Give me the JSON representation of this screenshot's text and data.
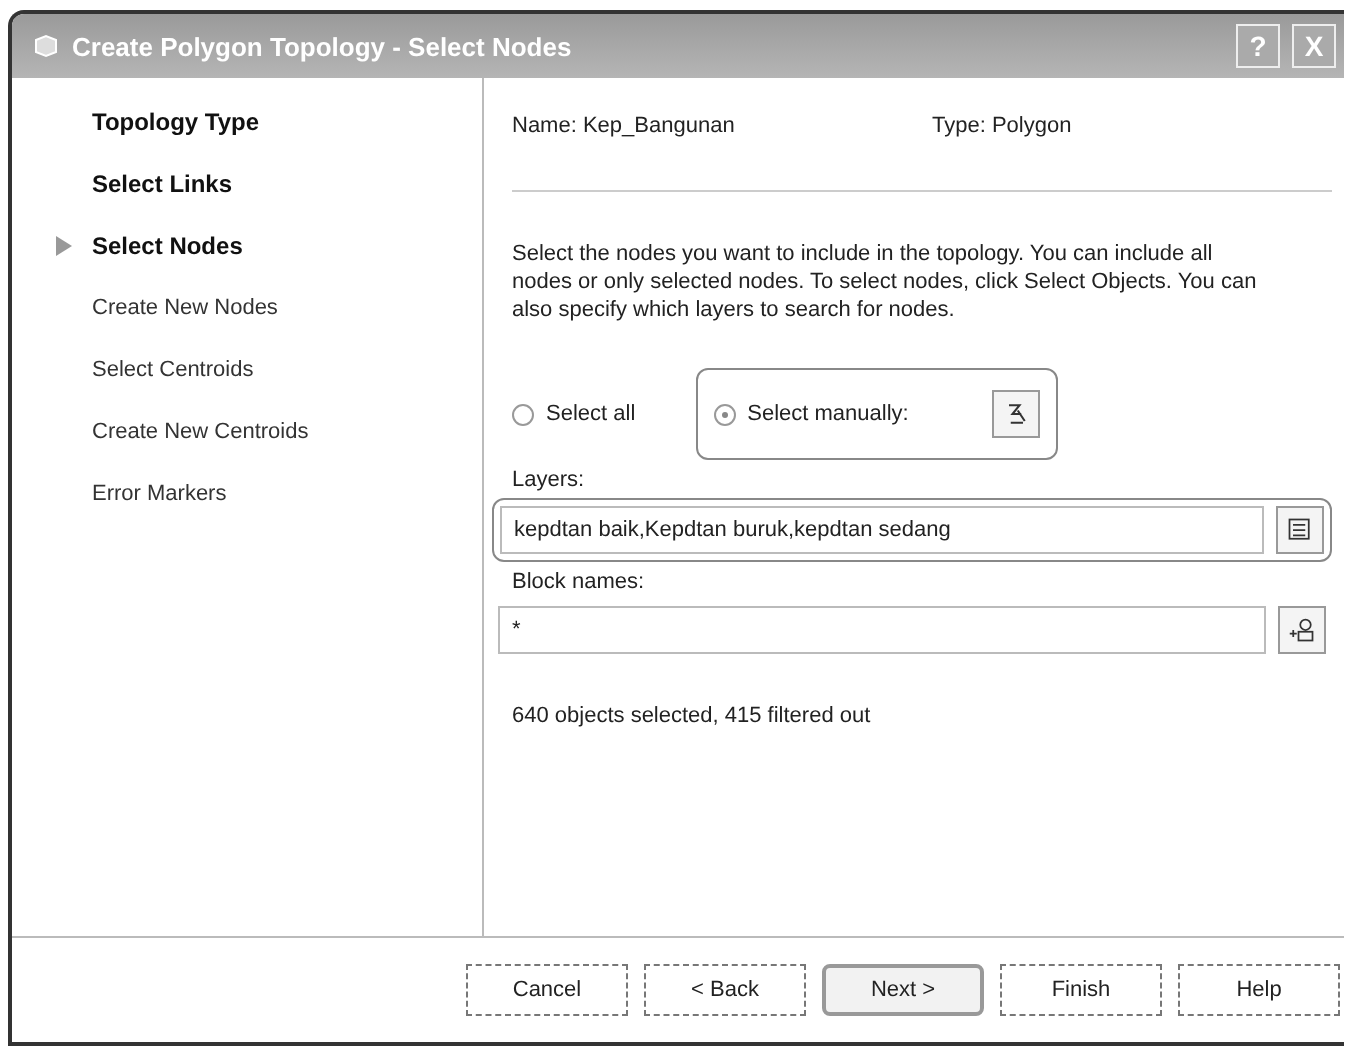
{
  "window": {
    "title": "Create Polygon Topology - Select Nodes",
    "help_button": "?",
    "close_button": "X"
  },
  "steps": [
    {
      "label": "Topology Type",
      "visited": true,
      "selected": false
    },
    {
      "label": "Select Links",
      "visited": true,
      "selected": false
    },
    {
      "label": "Select Nodes",
      "visited": true,
      "selected": true
    },
    {
      "label": "Create New Nodes",
      "visited": false,
      "selected": false
    },
    {
      "label": "Select Centroids",
      "visited": false,
      "selected": false
    },
    {
      "label": "Create New Centroids",
      "visited": false,
      "selected": false
    },
    {
      "label": "Error Markers",
      "visited": false,
      "selected": false
    }
  ],
  "info": {
    "name": "Name: Kep_Bangunan",
    "type": "Type: Polygon"
  },
  "description": "Select the nodes you want to include in the topology. You can include all nodes or only selected nodes. To select nodes, click Select Objects. You can also specify which layers to search for nodes.",
  "selection_mode": [
    {
      "label": "Select all",
      "selected": false
    },
    {
      "label": "Select manually:",
      "selected": true
    }
  ],
  "layers": {
    "label": "Layers:",
    "value": "kepdtan baik,Kepdtan buruk,kepdtan sedang"
  },
  "block_names": {
    "label": "Block names:",
    "value": "*"
  },
  "status": "640 objects selected, 415 filtered out",
  "buttons": [
    {
      "label": "Cancel",
      "default": false
    },
    {
      "label": "< Back",
      "default": false
    },
    {
      "label": "Next >",
      "default": true
    },
    {
      "label": "Finish",
      "default": false
    },
    {
      "label": "Help",
      "default": false
    }
  ]
}
